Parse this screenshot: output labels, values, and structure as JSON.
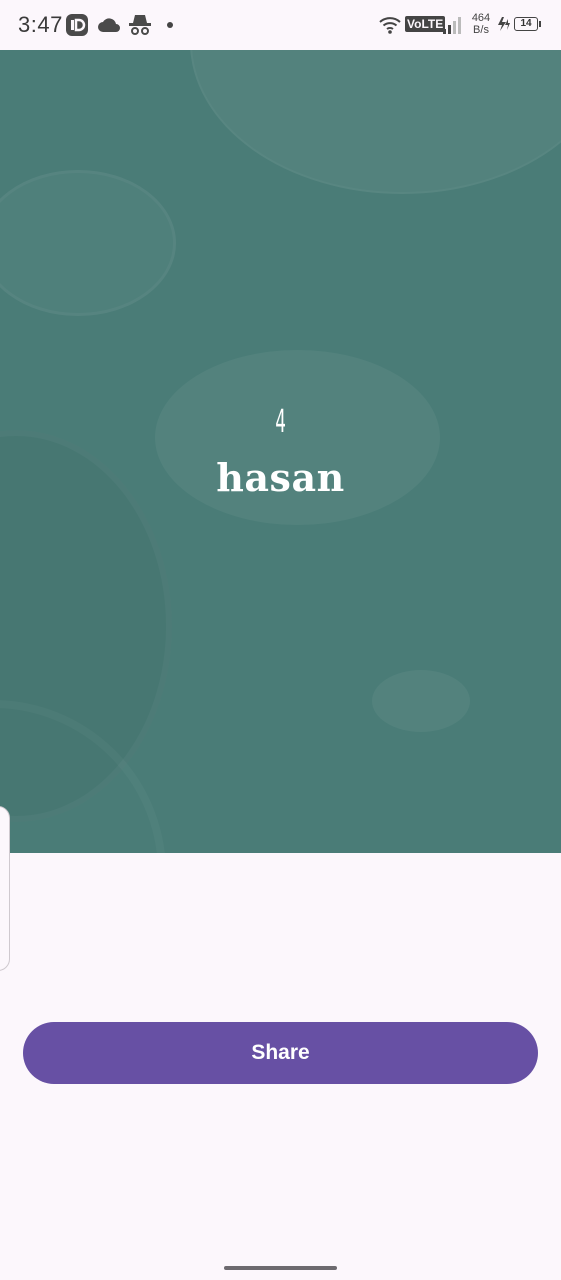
{
  "status_bar": {
    "time": "3:47",
    "network_type": "VoLTE",
    "speed_value": "464",
    "speed_unit": "B/s",
    "battery": "14",
    "icons": [
      "id-app-icon",
      "cloud-icon",
      "incognito-icon",
      "dot-icon",
      "wifi-icon",
      "signal-icon",
      "charging-icon",
      "battery-icon"
    ]
  },
  "card": {
    "number": "4",
    "name": "hasan",
    "background_color": "#4a7c77"
  },
  "actions": {
    "share_label": "Share",
    "accent_color": "#6750a4"
  }
}
